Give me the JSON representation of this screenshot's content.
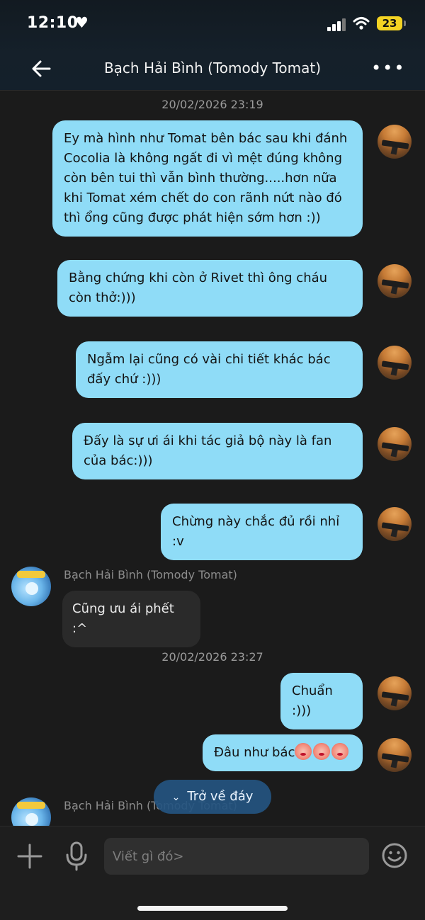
{
  "status": {
    "time": "12:10",
    "battery": "23"
  },
  "header": {
    "title": "Bạch Hải Bình (Tomody Tomat)"
  },
  "chat": {
    "timestamp_1": "20/02/2026 23:19",
    "timestamp_2": "20/02/2026 23:27",
    "messages_out_1": [
      "Ey mà hình như Tomat bên bác sau khi đánh Cocolia là không ngất đi vì mệt đúng không còn bên tui thì vẫn bình thường.....hơn nữa khi Tomat xém chết do con rãnh nứt nào đó thì ổng cũng được phát hiện sớm hơn :))",
      "Bằng chứng khi còn ở Rivet thì ông cháu còn thở:)))",
      "Ngẫm lại cũng có vài chi tiết khác bác đấy chứ :)))",
      "Đấy là sự ưi ái khi tác giả bộ này là fan của bác:)))",
      "Chừng này chắc đủ rồi nhỉ :v"
    ],
    "incoming_sender": "Bạch Hải Bình (Tomody Tomat)",
    "incoming_message": "Cũng ưu ái phết :^",
    "messages_out_2": [
      "Chuẩn :)))",
      "Đâu như bác"
    ],
    "incoming_sender_2": "Bạch Hải Bình (Tomody Tomat)"
  },
  "floating_button": {
    "label": "Trở về đáy"
  },
  "composer": {
    "placeholder": "Viết gì đó>"
  },
  "icons": [
    "back-arrow-icon",
    "more-icon",
    "plus-icon",
    "mic-icon",
    "smile-icon",
    "chevron-down-icon",
    "clown-emoji-icon"
  ],
  "colors": {
    "outgoing_bubble": "#8fdcf7",
    "incoming_bubble": "#2a2a2a",
    "background": "#1b1b1b",
    "floating_button": "#245480"
  }
}
